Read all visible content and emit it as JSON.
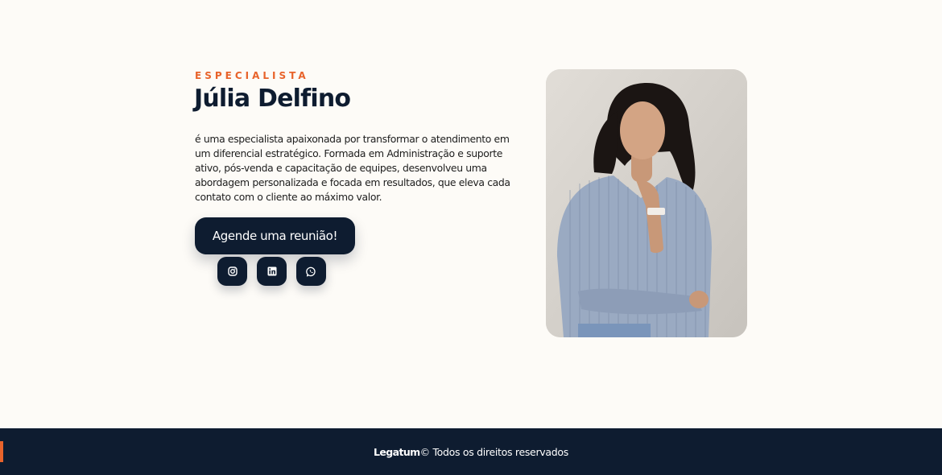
{
  "profile": {
    "eyebrow": "ESPECIALISTA",
    "name": "Júlia Delfino",
    "bio": "é uma especialista apaixonada por transformar o atendimento em um diferencial estratégico. Formada em Administração e suporte ativo, pós-venda e capacitação de equipes, desenvolveu uma abordagem personalizada e focada em resultados, que eleva cada contato com o cliente ao máximo valor.",
    "cta_label": "Agende uma reunião!"
  },
  "social_links": [
    {
      "name": "instagram",
      "icon": "instagram-icon"
    },
    {
      "name": "linkedin",
      "icon": "linkedin-icon"
    },
    {
      "name": "whatsapp",
      "icon": "whatsapp-icon"
    }
  ],
  "footer": {
    "brand": "Legatum",
    "copyright": "© Todos os direitos reservados"
  },
  "colors": {
    "background": "#fdfbf7",
    "navy": "#0e1c30",
    "accent": "#e8632b"
  }
}
